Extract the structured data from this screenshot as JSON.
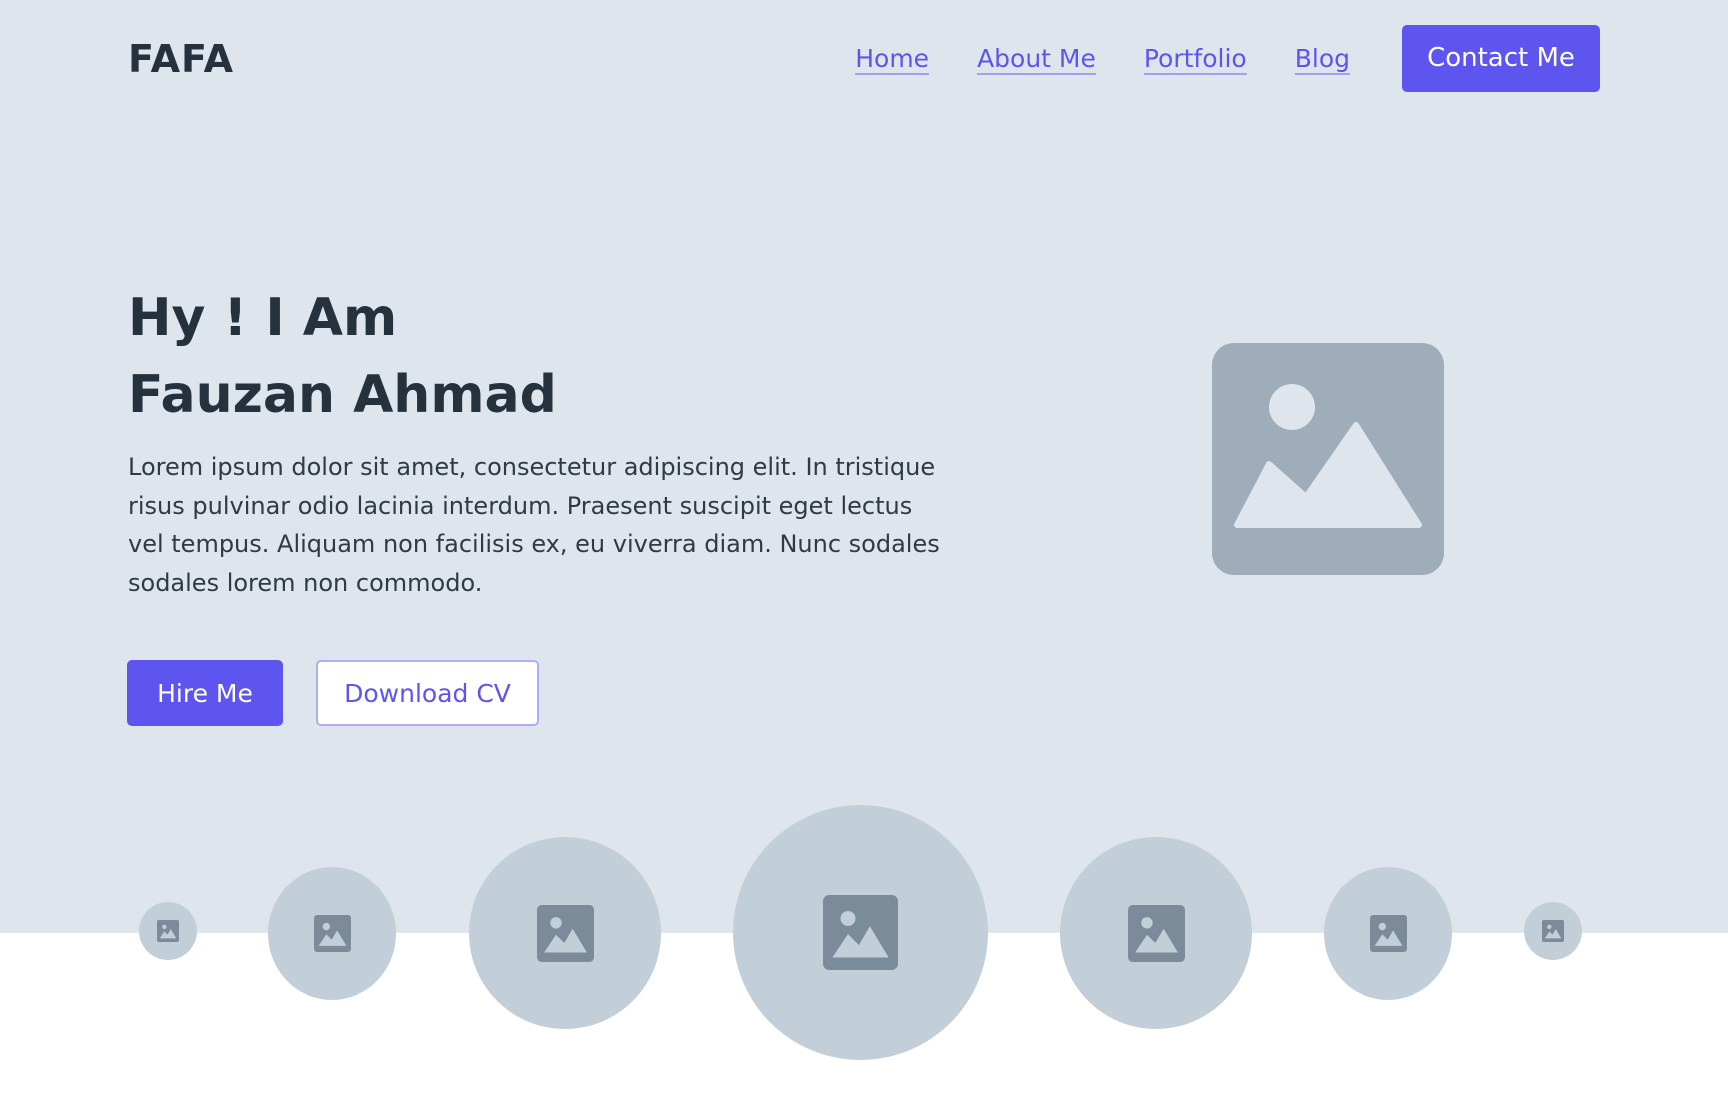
{
  "brand": {
    "logo": "FAFA"
  },
  "nav": {
    "items": [
      {
        "label": "Home"
      },
      {
        "label": "About Me"
      },
      {
        "label": "Portfolio"
      },
      {
        "label": "Blog"
      }
    ],
    "cta_label": "Contact Me"
  },
  "hero": {
    "title_line1": "Hy ! I Am",
    "title_line2": "Fauzan Ahmad",
    "description": "Lorem ipsum dolor sit amet, consectetur adipiscing elit. In tristique risus pulvinar odio lacinia interdum. Praesent suscipit eget lectus vel tempus. Aliquam non facilisis ex, eu viverra diam. Nunc sodales sodales lorem non commodo.",
    "primary_button": "Hire Me",
    "secondary_button": "Download CV",
    "image_icon": "image-placeholder-icon"
  },
  "gallery": {
    "icon": "image-placeholder-icon",
    "count": 7
  },
  "colors": {
    "accent": "#5e55ee",
    "hero_background": "#dfe5ed",
    "text_dark": "#25313d",
    "placeholder": "#9eadb9",
    "circle": "#c3cfd8",
    "circle_icon": "#7c8b99"
  }
}
